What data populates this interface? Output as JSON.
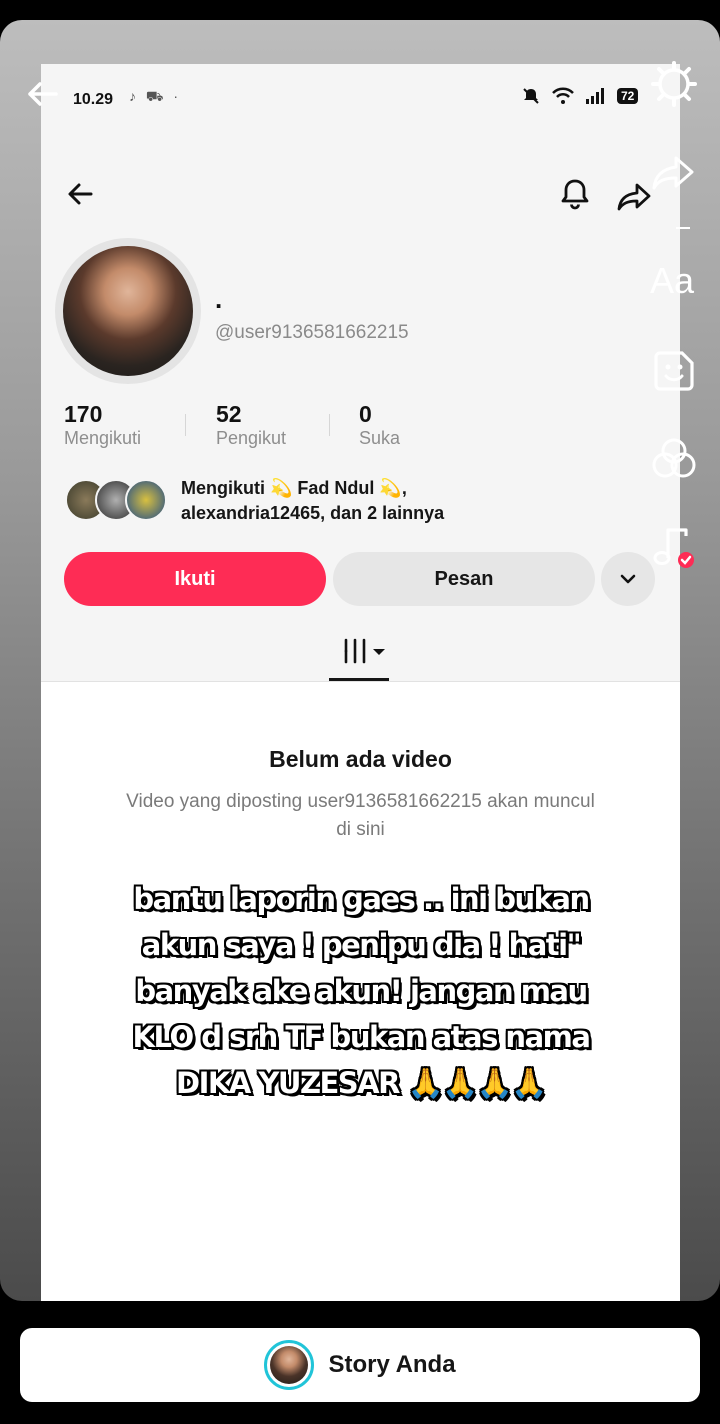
{
  "status_bar": {
    "time": "10.29",
    "app_icons": "♪ ⛟ ·",
    "battery": "72"
  },
  "profile": {
    "display_name": ".",
    "username": "@user9136581662215",
    "stats": [
      {
        "value": "170",
        "label": "Mengikuti"
      },
      {
        "value": "52",
        "label": "Pengikut"
      },
      {
        "value": "0",
        "label": "Suka"
      }
    ],
    "mutual_line1": "Mengikuti 💫 Fad Ndul 💫,",
    "mutual_line2": "alexandria12465, dan 2 lainnya",
    "follow_button": "Ikuti",
    "message_button": "Pesan"
  },
  "videos": {
    "empty_title": "Belum ada video",
    "empty_desc": "Video yang diposting user9136581662215 akan muncul di sini"
  },
  "overlay": {
    "text": "bantu laporin gaes .. ini bukan akun saya ! penipu dia ! hati\" banyak ake akun! jangan mau KLO d srh TF bukan atas nama DIKA YUZESAR 🙏🙏🙏🙏"
  },
  "story_editor": {
    "text_tool": "Aa",
    "story_label": "Story Anda"
  },
  "colors": {
    "follow_accent": "#fe2c55",
    "story_ring": "#21c4d8"
  }
}
